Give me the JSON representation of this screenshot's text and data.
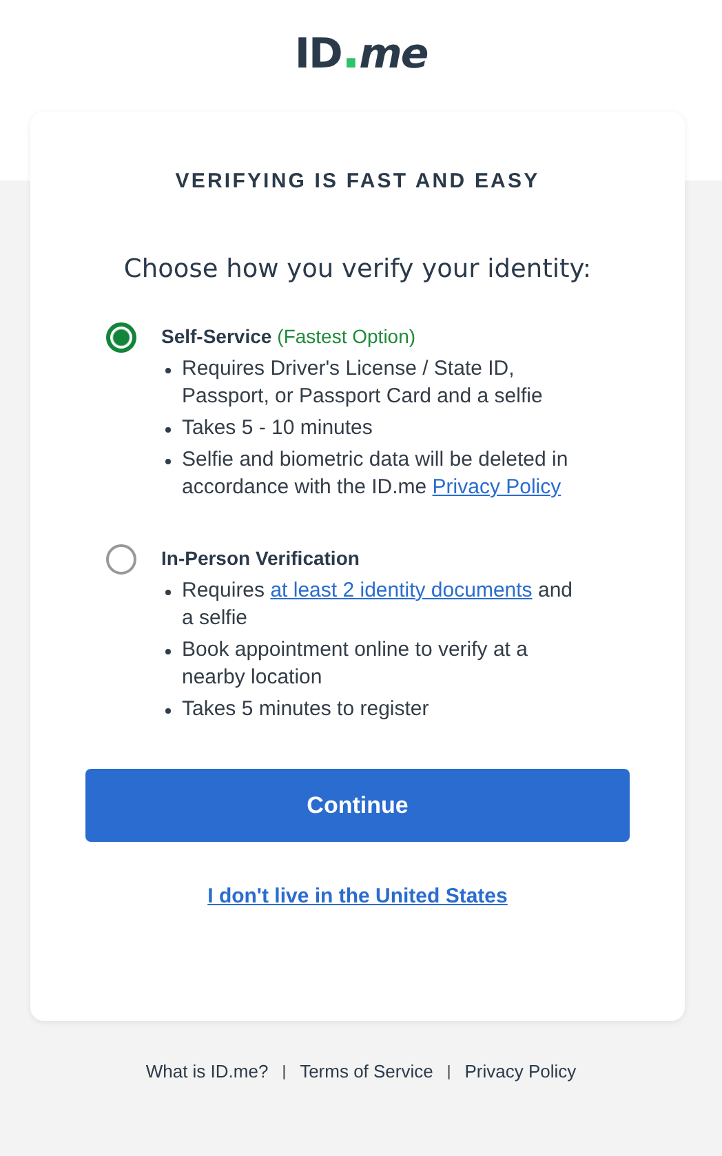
{
  "logo": {
    "main": "ID",
    "dot": ".",
    "accent": "me"
  },
  "card": {
    "heading": "VERIFYING IS FAST AND EASY",
    "question": "Choose how you verify your identity:",
    "options": [
      {
        "label": "Self-Service",
        "note": "(Fastest Option)",
        "selected": true,
        "bullets": [
          [
            {
              "text": "Requires Driver's License / State ID, Passport, or Passport Card and a selfie"
            }
          ],
          [
            {
              "text": "Takes 5 - 10 minutes"
            }
          ],
          [
            {
              "text": "Selfie and biometric data will be deleted in accordance with the ID.me "
            },
            {
              "link": "Privacy Policy"
            }
          ]
        ]
      },
      {
        "label": "In-Person Verification",
        "selected": false,
        "bullets": [
          [
            {
              "text": "Requires "
            },
            {
              "link": "at least 2 identity documents"
            },
            {
              "text": " and a selfie"
            }
          ],
          [
            {
              "text": "Book appointment online to verify at a nearby location"
            }
          ],
          [
            {
              "text": "Takes 5 minutes to register"
            }
          ]
        ]
      }
    ],
    "button": "Continue",
    "link": "I don't live in the United States"
  },
  "footer": {
    "links": [
      "What is ID.me?",
      "Terms of Service",
      "Privacy Policy"
    ],
    "separator": "|"
  }
}
